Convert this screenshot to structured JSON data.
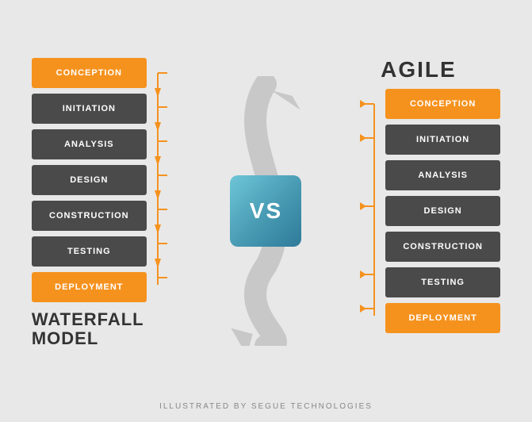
{
  "left": {
    "title": "WATERFALL\nMODEL",
    "steps": [
      {
        "label": "CONCEPTION",
        "type": "orange"
      },
      {
        "label": "INITIATION",
        "type": "dark"
      },
      {
        "label": "ANALYSIS",
        "type": "dark"
      },
      {
        "label": "DESIGN",
        "type": "dark"
      },
      {
        "label": "CONSTRUCTION",
        "type": "dark"
      },
      {
        "label": "TESTING",
        "type": "dark"
      },
      {
        "label": "DEPLOYMENT",
        "type": "orange"
      }
    ]
  },
  "center": {
    "vs_label": "VS"
  },
  "right": {
    "title": "AGILE",
    "steps": [
      {
        "label": "CONCEPTION",
        "type": "orange"
      },
      {
        "label": "INITIATION",
        "type": "dark"
      },
      {
        "label": "ANALYSIS",
        "type": "dark"
      },
      {
        "label": "DESIGN",
        "type": "dark"
      },
      {
        "label": "CONSTRUCTION",
        "type": "dark"
      },
      {
        "label": "TESTING",
        "type": "dark"
      },
      {
        "label": "DEPLOYMENT",
        "type": "orange"
      }
    ]
  },
  "footer": "ILLUSTRATED BY SEGUE TECHNOLOGIES"
}
